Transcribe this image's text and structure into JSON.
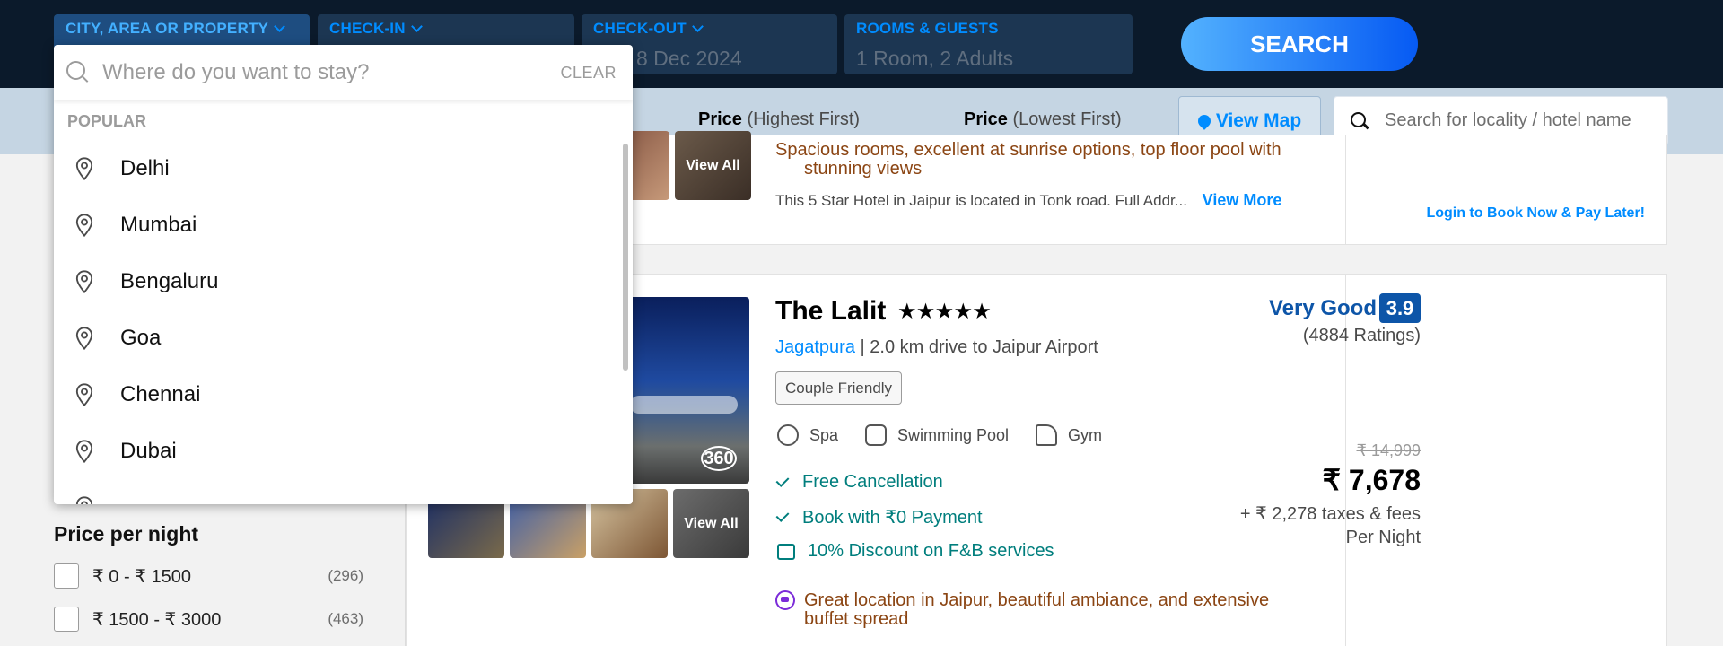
{
  "search": {
    "city_label": "CITY, AREA OR PROPERTY",
    "checkin_label": "CHECK-IN",
    "checkin_value": "",
    "checkout_label": "CHECK-OUT",
    "checkout_value": "8 Dec 2024",
    "rooms_label": "ROOMS & GUESTS",
    "rooms_value": "1 Room, 2 Adults",
    "search_button": "SEARCH"
  },
  "sortbar": {
    "sort_high_bold": "Price",
    "sort_high_rest": "(Highest First)",
    "sort_low_bold": "Price",
    "sort_low_rest": "(Lowest First)",
    "view_map": "View Map",
    "locality_placeholder": "Search for locality / hotel name"
  },
  "dropdown": {
    "placeholder": "Where do you want to stay?",
    "clear": "CLEAR",
    "section": "POPULAR",
    "items": [
      "Delhi",
      "Mumbai",
      "Bengaluru",
      "Goa",
      "Chennai",
      "Dubai"
    ]
  },
  "filters": {
    "price_title": "Price per night",
    "options": [
      {
        "label": "₹ 0 - ₹ 1500",
        "count": "(296)"
      },
      {
        "label": "₹ 1500 - ₹ 3000",
        "count": "(463)"
      }
    ]
  },
  "hotel1": {
    "view_all": "View All",
    "review_line1": "Spacious rooms, excellent at sunrise options, top floor pool with",
    "review_line2": "stunning views",
    "address": "This 5 Star Hotel in Jaipur is located in Tonk road. Full Addr...",
    "view_more": "View More",
    "login_link": "Login to Book Now & Pay Later!"
  },
  "hotel2": {
    "name": "The Lalit",
    "stars": 5,
    "area": "Jagatpura",
    "distance": " | 2.0 km drive to Jaipur Airport",
    "tag": "Couple Friendly",
    "amenities": [
      "Spa",
      "Swimming Pool",
      "Gym"
    ],
    "benefits": [
      "Free Cancellation",
      "Book with ₹0 Payment",
      "10% Discount on F&B services"
    ],
    "review_line1": "Great location in Jaipur, beautiful ambiance, and extensive",
    "review_line2": "buffet spread",
    "view_all": "View All",
    "rating_text": "Very Good",
    "rating_value": "3.9",
    "rating_count": "(4884 Ratings)",
    "original_price": "₹ 14,999",
    "final_price": "₹ 7,678",
    "taxes": "+ ₹ 2,278 taxes & fees",
    "per_night": "Per Night",
    "view_360": "360"
  },
  "colors": {
    "header_bg": "#0b1a2b",
    "accent": "#008cff",
    "rating": "#0d55a8",
    "benefit": "#007e7d",
    "review": "#8b4513"
  }
}
